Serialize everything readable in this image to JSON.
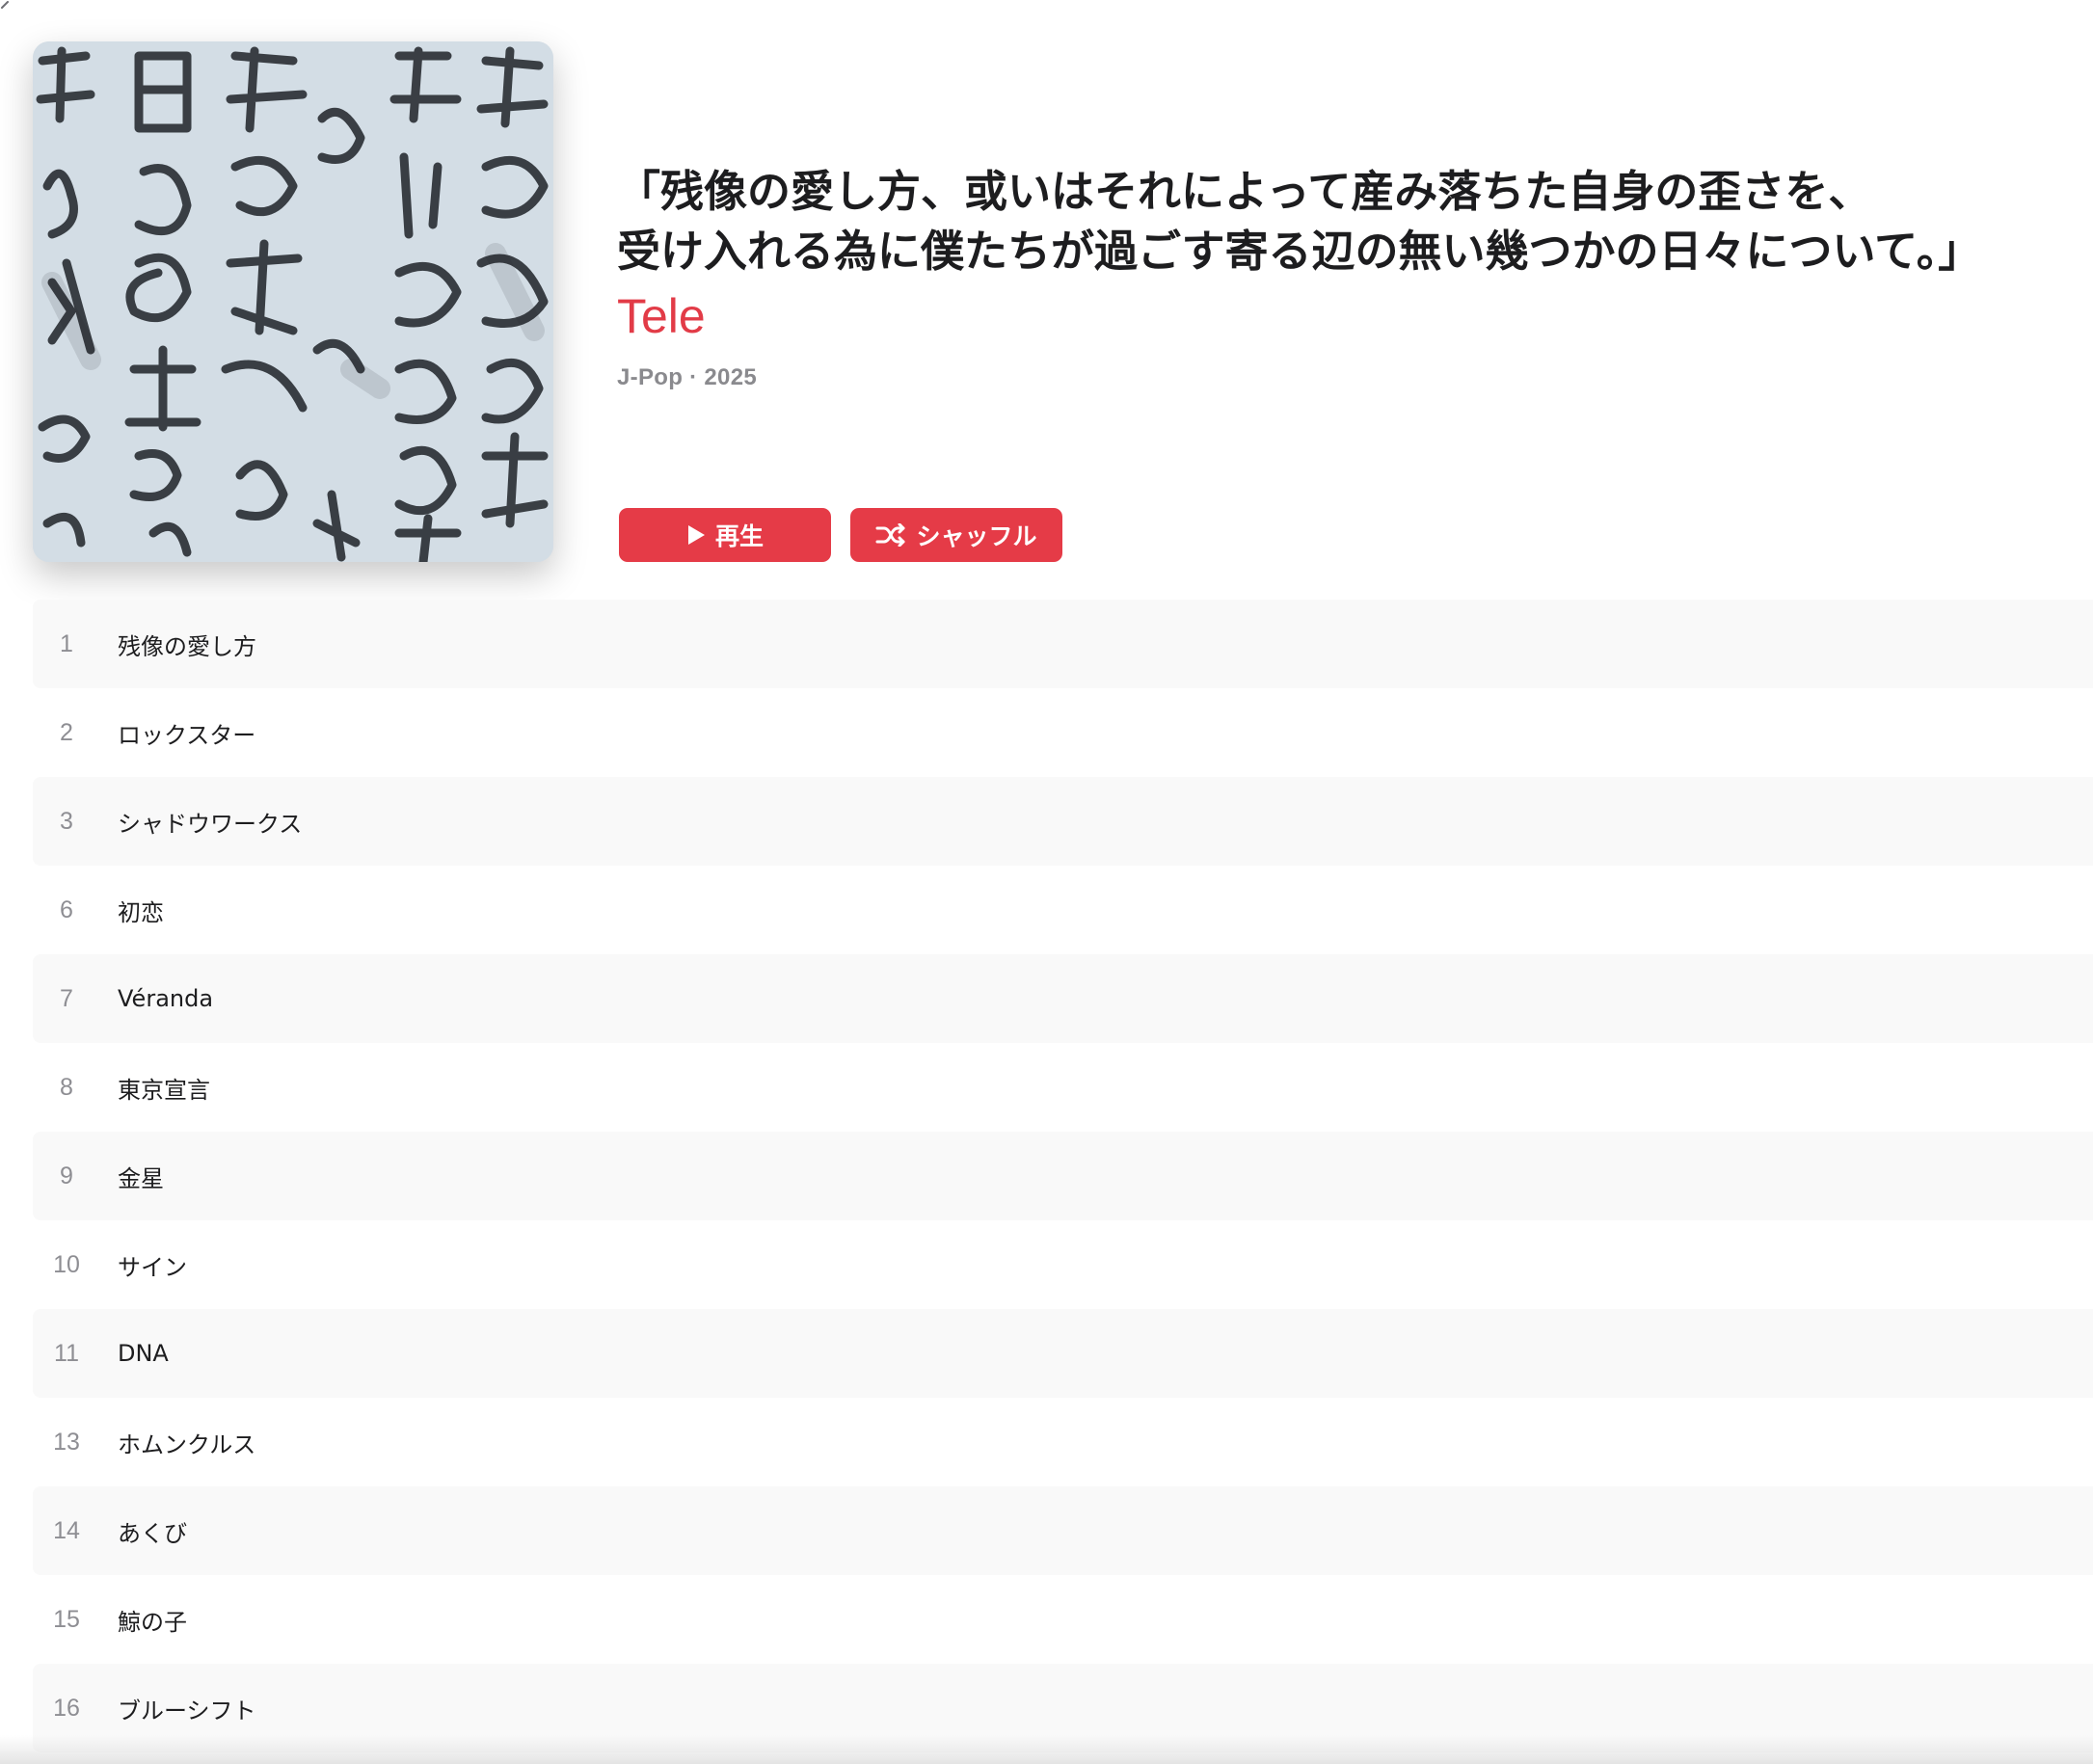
{
  "album": {
    "title_line1": "「残像の愛し方、或いはそれによって産み落ちた自身の歪さを、",
    "title_line2": "受け入れる為に僕たちが過ごす寄る辺の無い幾つかの日々について。」",
    "artist": "Tele",
    "meta": "J-Pop · 2025",
    "artwork_icon": "album-artwork-handwritten-kanji"
  },
  "buttons": {
    "play_label": "再生",
    "shuffle_label": "シャッフル"
  },
  "colors": {
    "accent": "#e53b47",
    "artist": "#e23b47",
    "meta": "#8a8a8e",
    "row_alt": "#f9f9f9"
  },
  "tracks": [
    {
      "num": "1",
      "title": "残像の愛し方"
    },
    {
      "num": "2",
      "title": "ロックスター"
    },
    {
      "num": "3",
      "title": "シャドウワークス"
    },
    {
      "num": "6",
      "title": "初恋"
    },
    {
      "num": "7",
      "title": "Véranda"
    },
    {
      "num": "8",
      "title": "東京宣言"
    },
    {
      "num": "9",
      "title": "金星"
    },
    {
      "num": "10",
      "title": "サイン"
    },
    {
      "num": "11",
      "title": "DNA"
    },
    {
      "num": "13",
      "title": "ホムンクルス"
    },
    {
      "num": "14",
      "title": "あくび"
    },
    {
      "num": "15",
      "title": "鯨の子"
    },
    {
      "num": "16",
      "title": "ブルーシフト"
    }
  ]
}
